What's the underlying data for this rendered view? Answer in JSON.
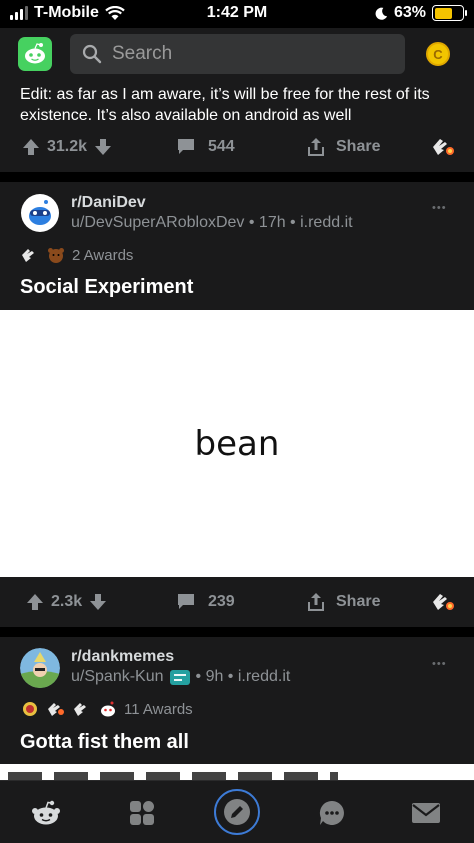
{
  "status_bar": {
    "carrier": "T-Mobile",
    "time": "1:42 PM",
    "battery": "63%",
    "battery_level": 0.63
  },
  "header": {
    "search_placeholder": "Search",
    "coin_label": "C"
  },
  "top_post": {
    "partial_line": "Edit: as far as I am aware, it’s will be free for the rest of its existence. It’s also available on android as well",
    "upvotes": "31.2k",
    "comments": "544",
    "share_label": "Share"
  },
  "post1": {
    "subreddit": "r/DaniDev",
    "meta": "u/DevSuperARobloxDev • 17h • i.redd.it",
    "awards": "2 Awards",
    "title": "Social Experiment",
    "image_text": "bean",
    "upvotes": "2.3k",
    "comments": "239",
    "share_label": "Share"
  },
  "post2": {
    "subreddit": "r/dankmemes",
    "user": "u/Spank-Kun",
    "meta_tail": "• 9h • i.redd.it",
    "awards": "11 Awards",
    "title": "Gotta fist them all"
  },
  "more_label": "•••",
  "colors": {
    "background": "#000000",
    "card": "#1a1a1b",
    "accent_green": "#46d160",
    "coin": "#f2c500",
    "tab_accent": "#3d7bd6"
  },
  "icons": {
    "tabs": [
      "home-icon",
      "communities-icon",
      "create-post-icon",
      "chat-icon",
      "inbox-icon"
    ]
  }
}
